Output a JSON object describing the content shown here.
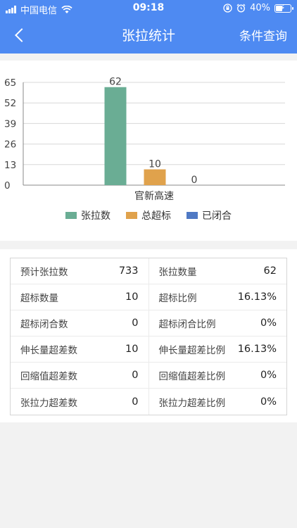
{
  "status_bar": {
    "carrier": "中国电信",
    "time": "09:18",
    "battery": "40%"
  },
  "nav": {
    "title": "张拉统计",
    "action": "条件查询"
  },
  "chart_data": {
    "type": "bar",
    "categories": [
      "官新高速"
    ],
    "series": [
      {
        "name": "张拉数",
        "values": [
          62
        ],
        "color": "#6aad94"
      },
      {
        "name": "总超标",
        "values": [
          10
        ],
        "color": "#e0a24c"
      },
      {
        "name": "已闭合",
        "values": [
          0
        ],
        "color": "#4f79c4"
      }
    ],
    "ylim": [
      0,
      65
    ],
    "yticks": [
      0,
      13,
      26,
      39,
      52,
      65
    ],
    "grid": true,
    "legend_position": "bottom",
    "title": "",
    "xlabel": "",
    "ylabel": ""
  },
  "stats": {
    "rows": [
      [
        {
          "label": "预计张拉数",
          "value": "733"
        },
        {
          "label": "张拉数量",
          "value": "62"
        }
      ],
      [
        {
          "label": "超标数量",
          "value": "10"
        },
        {
          "label": "超标比例",
          "value": "16.13%"
        }
      ],
      [
        {
          "label": "超标闭合数",
          "value": "0"
        },
        {
          "label": "超标闭合比例",
          "value": "0%"
        }
      ],
      [
        {
          "label": "伸长量超差数",
          "value": "10"
        },
        {
          "label": "伸长量超差比例",
          "value": "16.13%"
        }
      ],
      [
        {
          "label": "回缩值超差数",
          "value": "0"
        },
        {
          "label": "回缩值超差比例",
          "value": "0%"
        }
      ],
      [
        {
          "label": "张拉力超差数",
          "value": "0"
        },
        {
          "label": "张拉力超差比例",
          "value": "0%"
        }
      ]
    ]
  }
}
